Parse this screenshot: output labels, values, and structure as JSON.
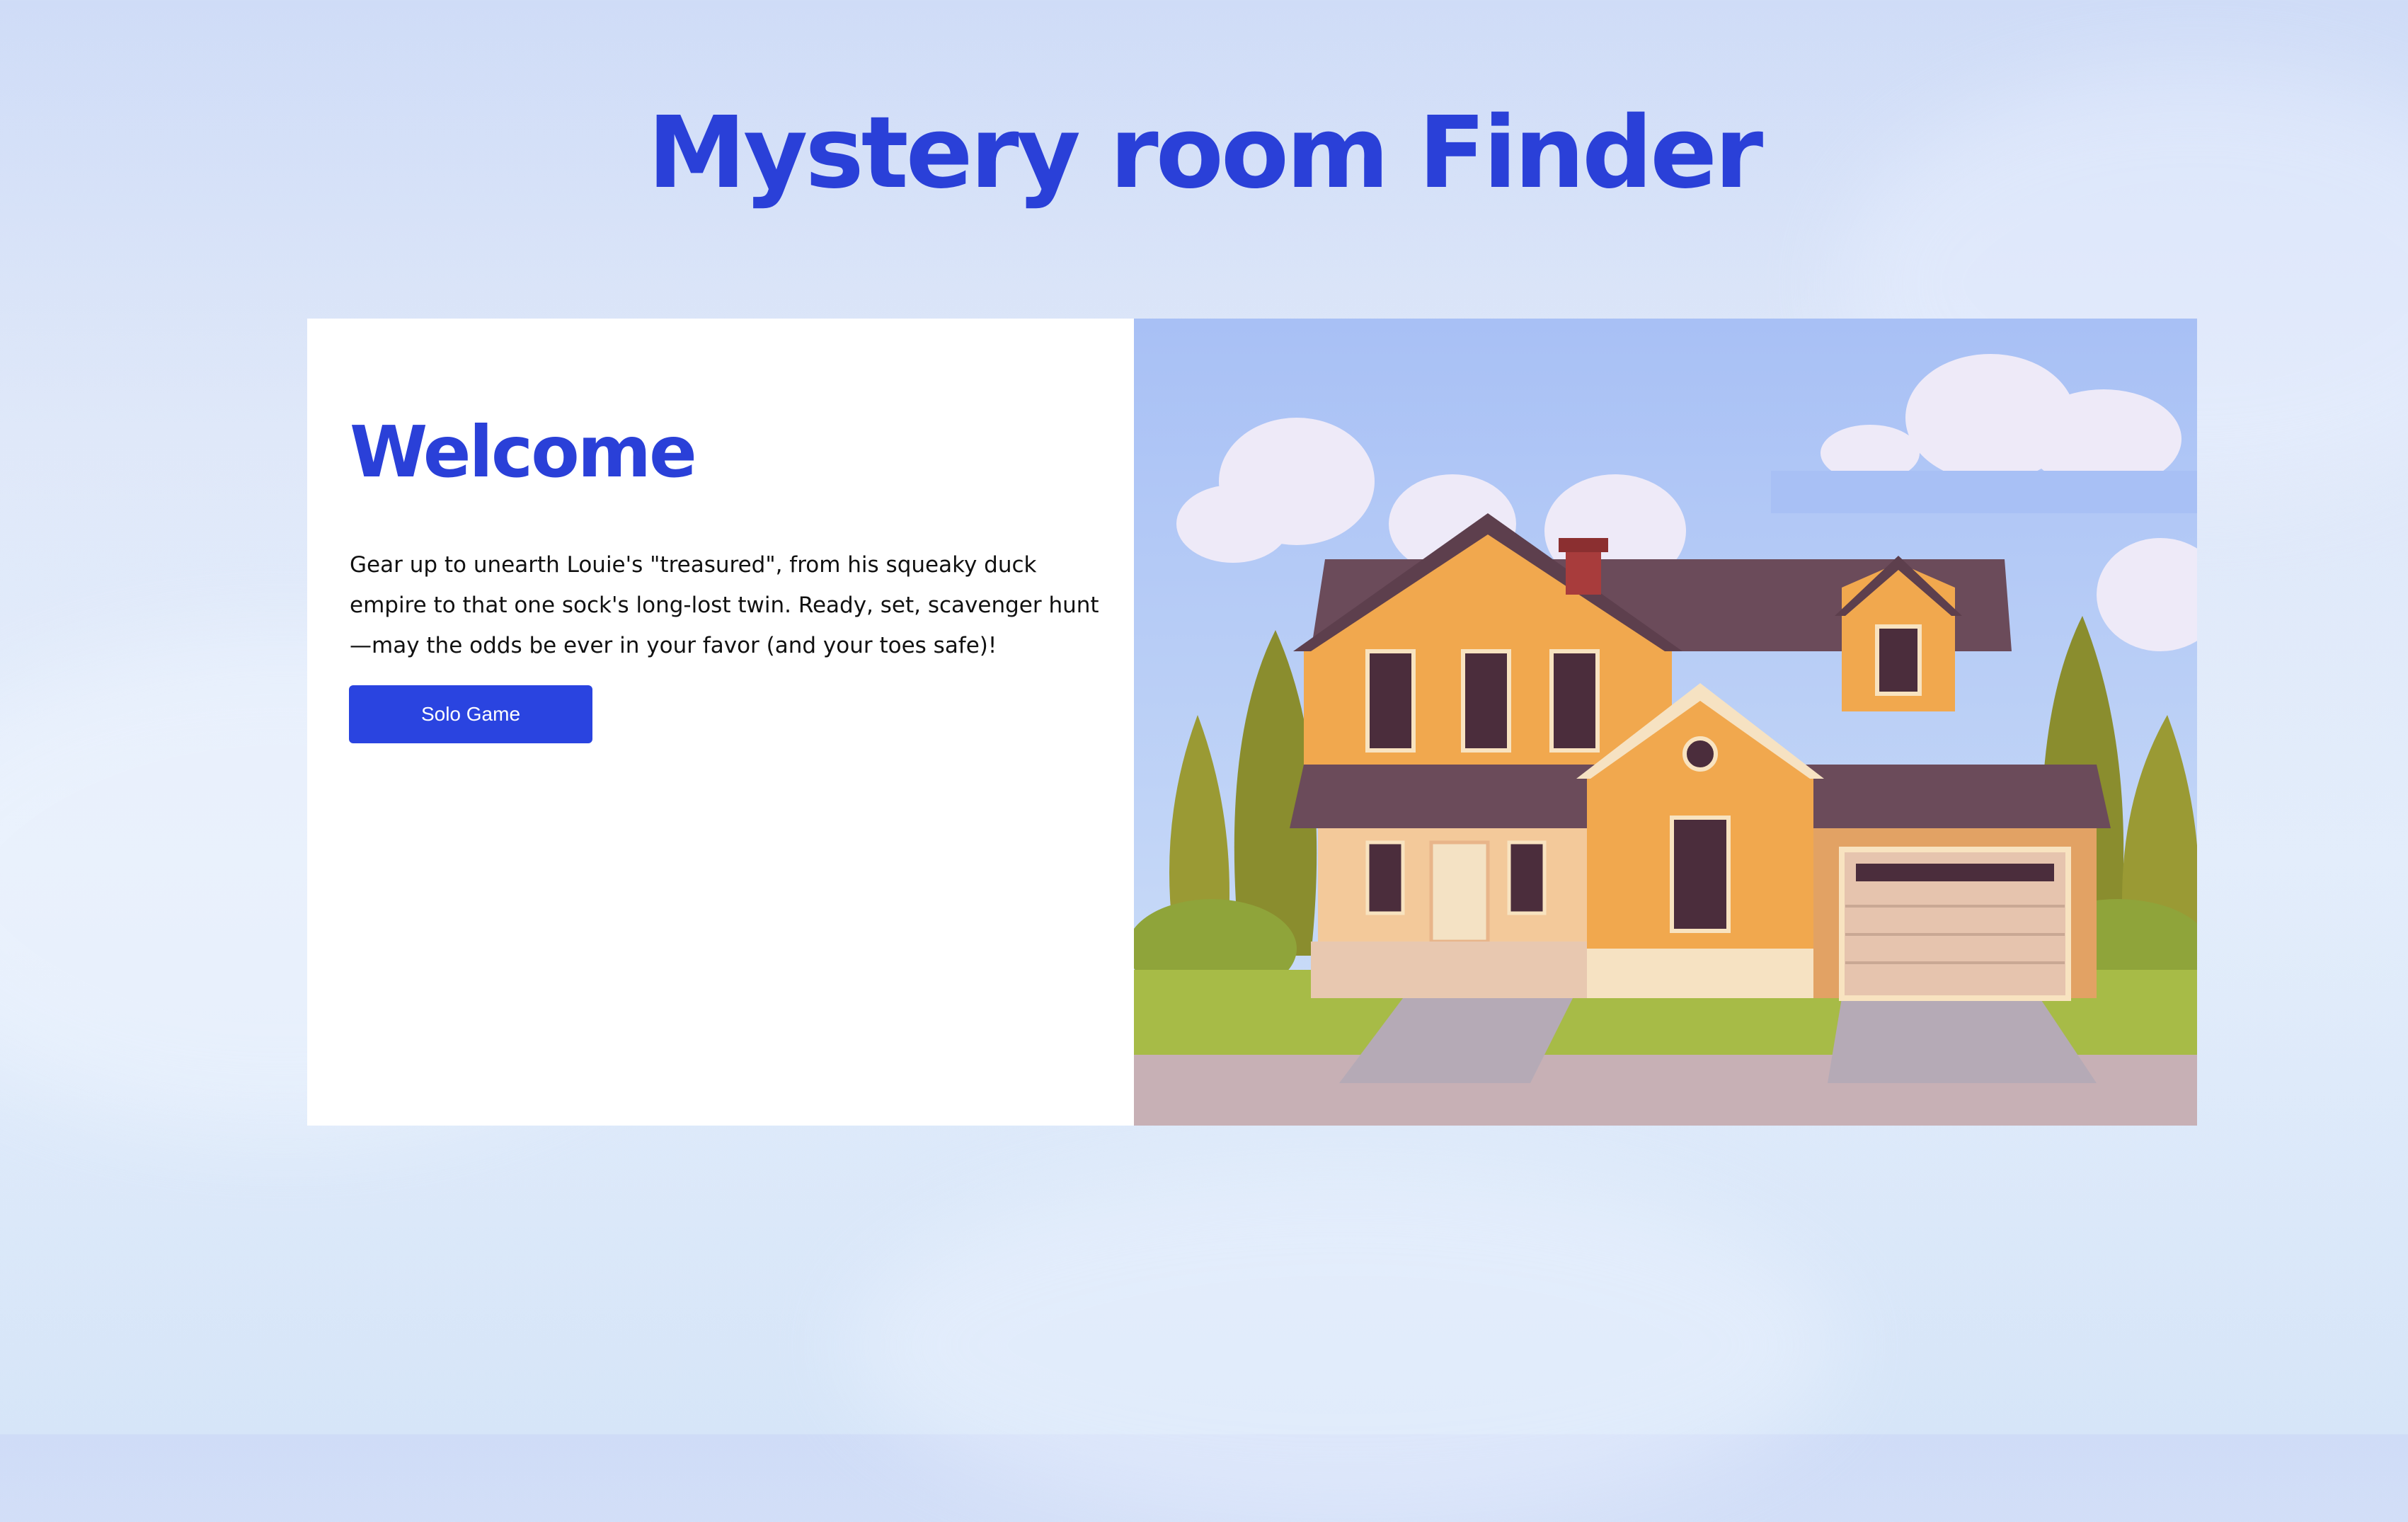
{
  "page": {
    "title": "Mystery room Finder"
  },
  "welcome_card": {
    "heading": "Welcome",
    "description": "Gear up to unearth Louie's \"treasured\", from his squeaky duck empire to that one sock's long-lost twin. Ready, set, scavenger hunt—may the odds be ever in your favor (and your toes safe)!",
    "solo_button_label": "Solo Game"
  },
  "illustration": {
    "subject": "house-illustration"
  },
  "colors": {
    "accent": "#2a40d8",
    "button": "#2a44e0",
    "card_bg": "#ffffff"
  }
}
